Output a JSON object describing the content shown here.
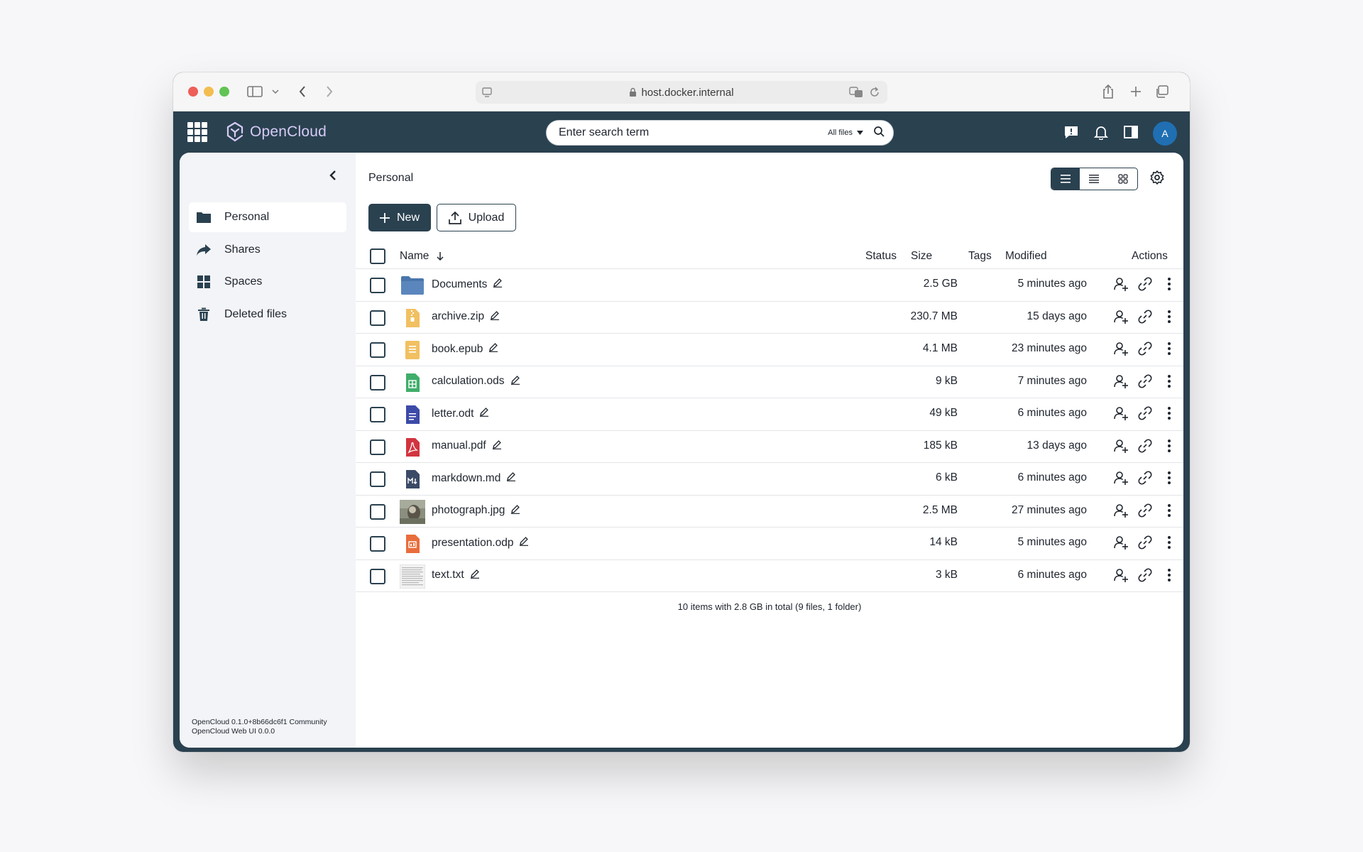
{
  "browser": {
    "url": "host.docker.internal"
  },
  "appbar": {
    "brand": "OpenCloud",
    "search_placeholder": "Enter search term",
    "search_scope": "All files",
    "avatar_initial": "A"
  },
  "sidebar": {
    "items": [
      {
        "label": "Personal",
        "icon": "folder-icon"
      },
      {
        "label": "Shares",
        "icon": "share-arrow-icon"
      },
      {
        "label": "Spaces",
        "icon": "grid-icon"
      },
      {
        "label": "Deleted files",
        "icon": "trash-icon"
      }
    ],
    "version_line1": "OpenCloud 0.1.0+8b66dc6f1 Community",
    "version_line2": "OpenCloud Web UI 0.0.0"
  },
  "main": {
    "breadcrumb": "Personal",
    "new_label": "New",
    "upload_label": "Upload",
    "columns": {
      "name": "Name",
      "status": "Status",
      "size": "Size",
      "tags": "Tags",
      "modified": "Modified",
      "actions": "Actions"
    },
    "files": [
      {
        "name": "Documents",
        "type": "folder",
        "size": "2.5 GB",
        "modified": "5 minutes ago"
      },
      {
        "name": "archive.zip",
        "type": "zip",
        "size": "230.7 MB",
        "modified": "15 days ago"
      },
      {
        "name": "book.epub",
        "type": "epub",
        "size": "4.1 MB",
        "modified": "23 minutes ago"
      },
      {
        "name": "calculation.ods",
        "type": "spreadsheet",
        "size": "9 kB",
        "modified": "7 minutes ago"
      },
      {
        "name": "letter.odt",
        "type": "document",
        "size": "49 kB",
        "modified": "6 minutes ago"
      },
      {
        "name": "manual.pdf",
        "type": "pdf",
        "size": "185 kB",
        "modified": "13 days ago"
      },
      {
        "name": "markdown.md",
        "type": "markdown",
        "size": "6 kB",
        "modified": "6 minutes ago"
      },
      {
        "name": "photograph.jpg",
        "type": "image",
        "size": "2.5 MB",
        "modified": "27 minutes ago"
      },
      {
        "name": "presentation.odp",
        "type": "presentation",
        "size": "14 kB",
        "modified": "5 minutes ago"
      },
      {
        "name": "text.txt",
        "type": "text",
        "size": "3 kB",
        "modified": "6 minutes ago"
      }
    ],
    "summary": "10 items with 2.8 GB in total (9 files, 1 folder)"
  }
}
